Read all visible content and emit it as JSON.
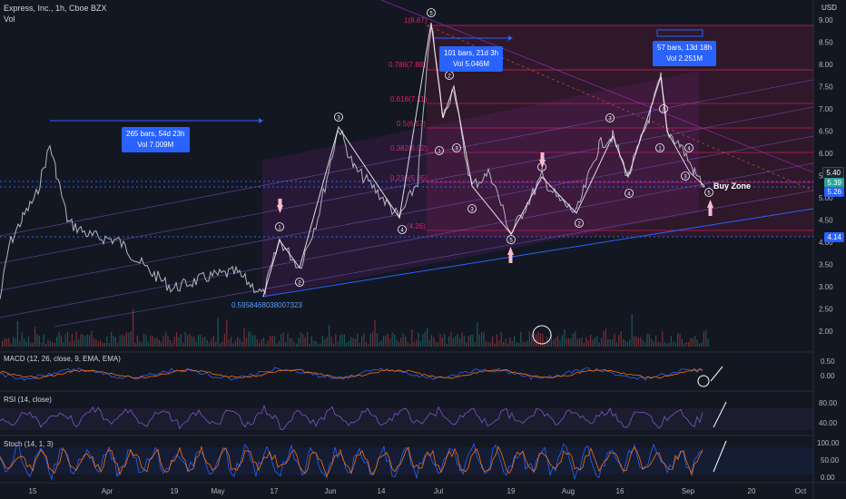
{
  "header": {
    "symbol": "Express, Inc., 1h, Cboe BZX",
    "volume_label": "Vol"
  },
  "price_axis": {
    "currency": "USD",
    "ticks": [
      "9.00",
      "8.50",
      "8.00",
      "7.50",
      "7.00",
      "6.50",
      "6.00",
      "5.50",
      "5.00",
      "4.50",
      "4.00",
      "3.50",
      "3.00",
      "2.50",
      "2.00"
    ],
    "price_tags": [
      {
        "value": "5.40",
        "color": "#1e222d"
      },
      {
        "value": "5.39",
        "color": "#26a69a"
      },
      {
        "value": "5.26",
        "color": "#2962ff"
      },
      {
        "value": "4.14",
        "color": "#2962ff"
      }
    ]
  },
  "time_axis": [
    "15",
    "Apr",
    "19",
    "May",
    "17",
    "Jun",
    "14",
    "Jul",
    "19",
    "Aug",
    "16",
    "Sep",
    "20",
    "Oct"
  ],
  "fib_levels": [
    "1(8.87)",
    "0.786(7.88)",
    "0.618(7.11)",
    "0.5(6.57)",
    "0.382(6.02)",
    "0.236(5.35)",
    "(4.26)"
  ],
  "callouts": [
    {
      "line1": "265 bars, 54d 23h",
      "line2": "Vol 7.009M"
    },
    {
      "line1": "101 bars, 21d 3h",
      "line2": "Vol 5.046M"
    },
    {
      "line1": "57 bars, 13d 18h",
      "line2": "Vol 2.251M"
    }
  ],
  "annotations": {
    "buy_zone": "Buy Zone",
    "low_value": "0.5958468038007323",
    "waves": [
      "1",
      "2",
      "3",
      "4",
      "5"
    ]
  },
  "indicators": {
    "macd": {
      "label": "MACD (12, 26, close, 9, EMA, EMA)",
      "ticks": [
        "0.50",
        "0.00"
      ]
    },
    "rsi": {
      "label": "RSI (14, close)",
      "ticks": [
        "80.00",
        "40.00"
      ]
    },
    "stoch": {
      "label": "Stoch (14, 1, 3)",
      "ticks": [
        "100.00",
        "50.00",
        "0.00"
      ]
    }
  },
  "colors": {
    "background": "#131722",
    "accent": "#2962ff",
    "channel": "#9c27b0",
    "fib_zone": "#e91e63",
    "up": "#26a69a",
    "down": "#ef5350"
  }
}
